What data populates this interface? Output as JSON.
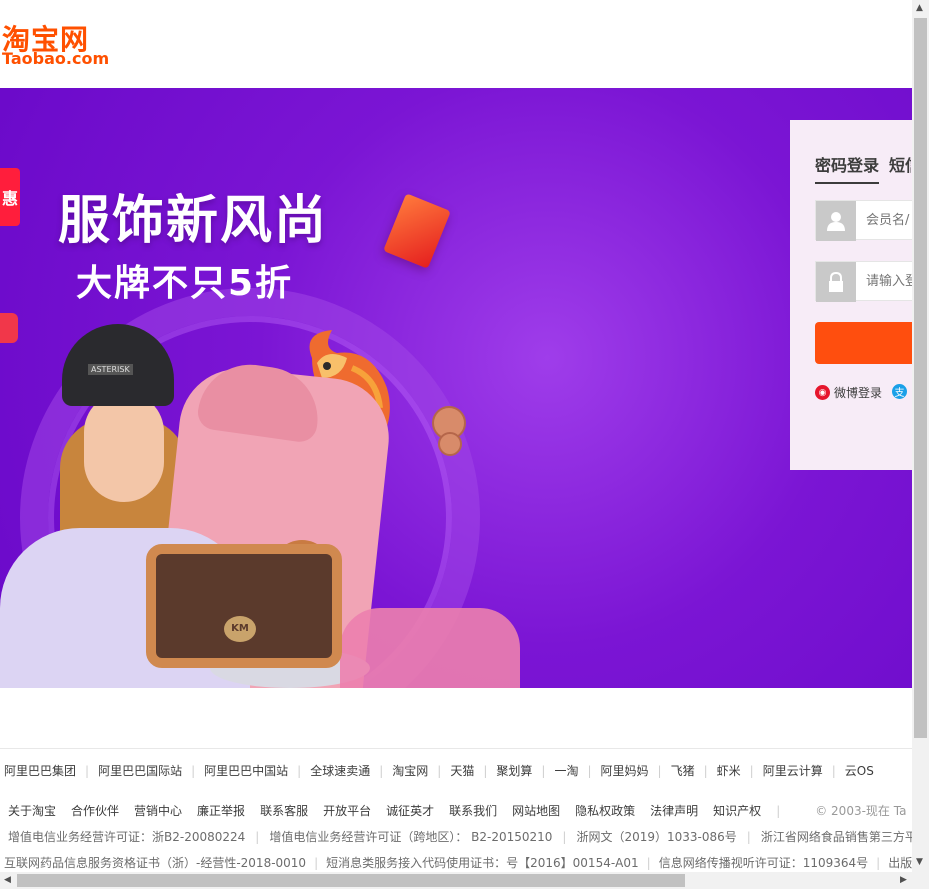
{
  "header": {
    "logo_cn": "淘宝网",
    "logo_en": "Taobao.com"
  },
  "banner": {
    "headline": "服饰新风尚",
    "subline": "大牌不只5折",
    "side_tag": "惠",
    "beanie_text": "ASTERISK",
    "bag_logo_text": "KM"
  },
  "login": {
    "tab_password": "密码登录",
    "tab_sms": "短信",
    "username_placeholder": "会员名/",
    "password_placeholder": "请输入登",
    "weibo_label": "微博登录",
    "alipay_label": "支"
  },
  "footer": {
    "friend_links": [
      "阿里巴巴集团",
      "阿里巴巴国际站",
      "阿里巴巴中国站",
      "全球速卖通",
      "淘宝网",
      "天猫",
      "聚划算",
      "一淘",
      "阿里妈妈",
      "飞猪",
      "虾米",
      "阿里云计算",
      "云OS"
    ],
    "nav_links": [
      "关于淘宝",
      "合作伙伴",
      "营销中心",
      "廉正举报",
      "联系客服",
      "开放平台",
      "诚征英才",
      "联系我们",
      "网站地图",
      "隐私权政策",
      "法律声明",
      "知识产权"
    ],
    "copyright": "© 2003-现在 Ta",
    "licenses": [
      "增值电信业务经营许可证：浙B2-20080224",
      "增值电信业务经营许可证（跨地区）： B2-20150210",
      "浙网文（2019）1033-086号",
      "浙江省网络食品销售第三方平台"
    ],
    "licenses2": [
      "互联网药品信息服务资格证书（浙）-经营性-2018-0010",
      "短消息类服务接入代码使用证书：号【2016】00154-A01",
      "信息网络传播视听许可证：1109364号",
      "出版物网"
    ]
  }
}
